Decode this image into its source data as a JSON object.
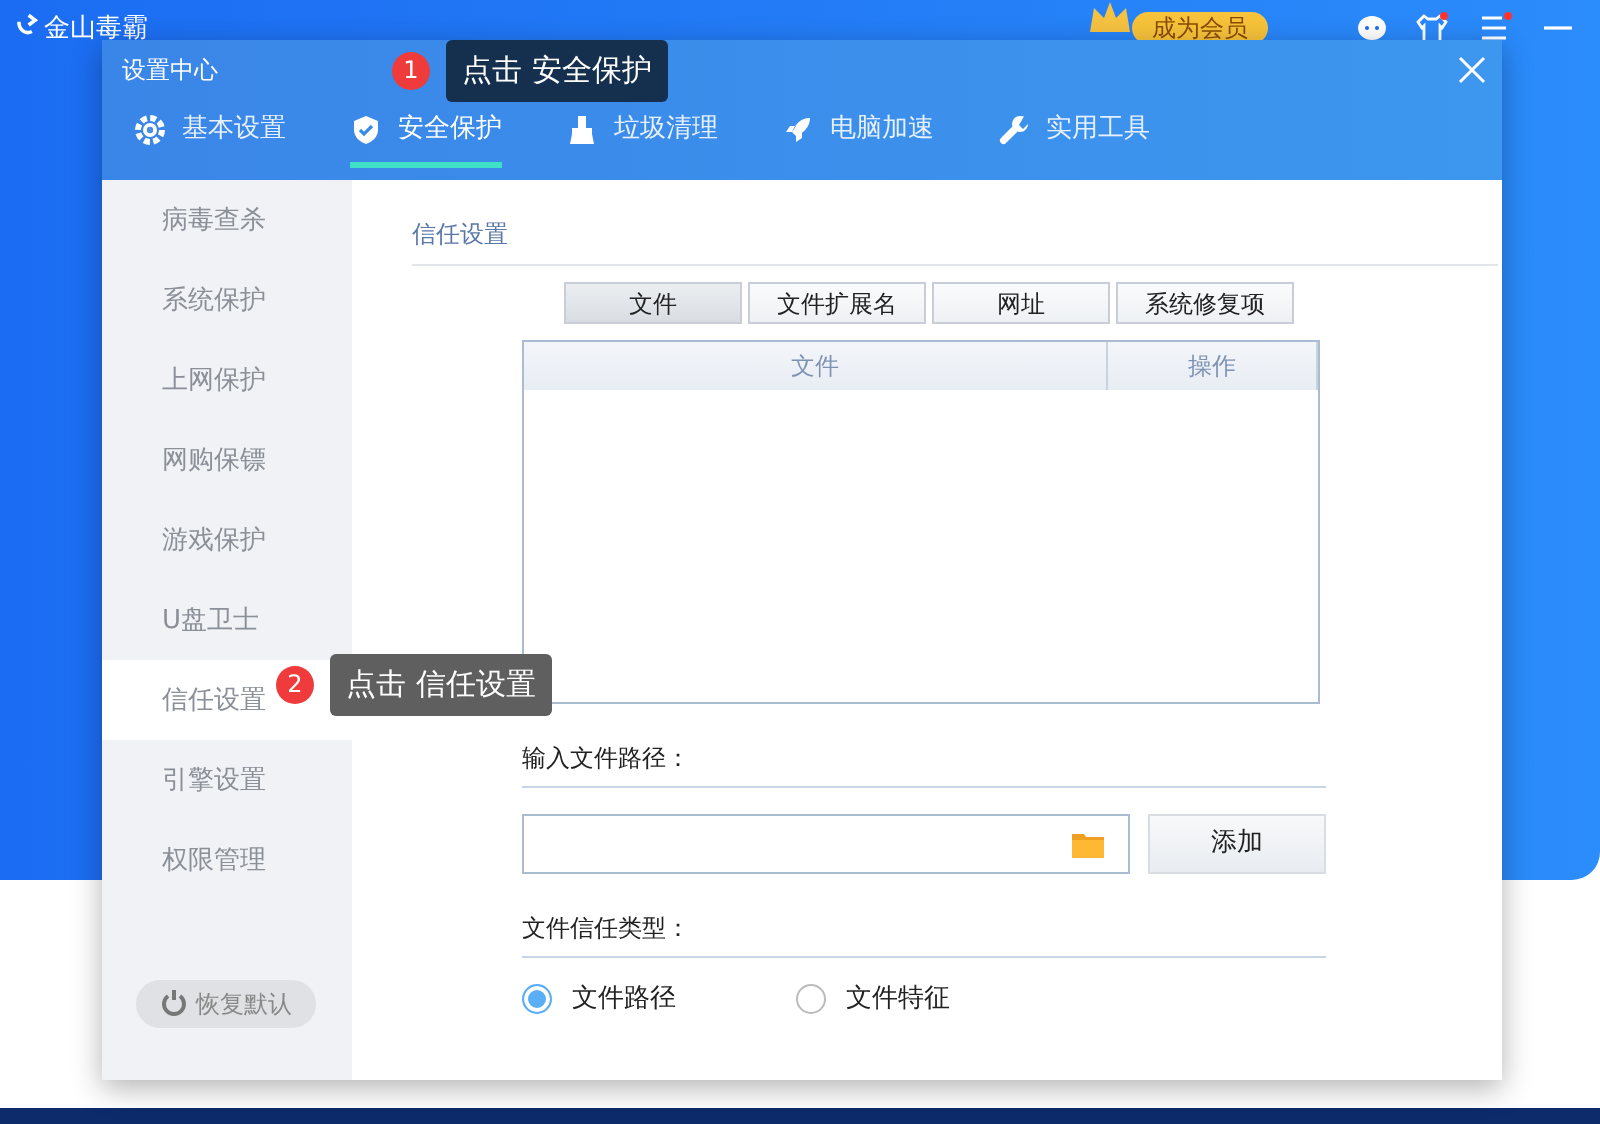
{
  "app": {
    "title": "金山毒霸",
    "vip_button": "成为会员"
  },
  "dialog": {
    "title": "设置中心",
    "tabs": [
      {
        "label": "基本设置",
        "selected": false
      },
      {
        "label": "安全保护",
        "selected": true
      },
      {
        "label": "垃圾清理",
        "selected": false
      },
      {
        "label": "电脑加速",
        "selected": false
      },
      {
        "label": "实用工具",
        "selected": false
      }
    ],
    "sidebar": {
      "items": [
        {
          "label": "病毒查杀",
          "selected": false
        },
        {
          "label": "系统保护",
          "selected": false
        },
        {
          "label": "上网保护",
          "selected": false
        },
        {
          "label": "网购保镖",
          "selected": false
        },
        {
          "label": "游戏保护",
          "selected": false
        },
        {
          "label": "U盘卫士",
          "selected": false
        },
        {
          "label": "信任设置",
          "selected": true
        },
        {
          "label": "引擎设置",
          "selected": false
        },
        {
          "label": "权限管理",
          "selected": false
        }
      ],
      "reset_button": "恢复默认"
    },
    "section_title": "信任设置",
    "filter_tabs": [
      {
        "label": "文件",
        "selected": true
      },
      {
        "label": "文件扩展名",
        "selected": false
      },
      {
        "label": "网址",
        "selected": false
      },
      {
        "label": "系统修复项",
        "selected": false
      }
    ],
    "table": {
      "columns": [
        "文件",
        "操作"
      ]
    },
    "path_label": "输入文件路径：",
    "add_button": "添加",
    "type_label": "文件信任类型：",
    "radios": [
      {
        "label": "文件路径",
        "selected": true
      },
      {
        "label": "文件特征",
        "selected": false
      }
    ]
  },
  "callouts": [
    {
      "number": "1",
      "text": "点击 安全保护"
    },
    {
      "number": "2",
      "text": "点击 信任设置"
    }
  ]
}
